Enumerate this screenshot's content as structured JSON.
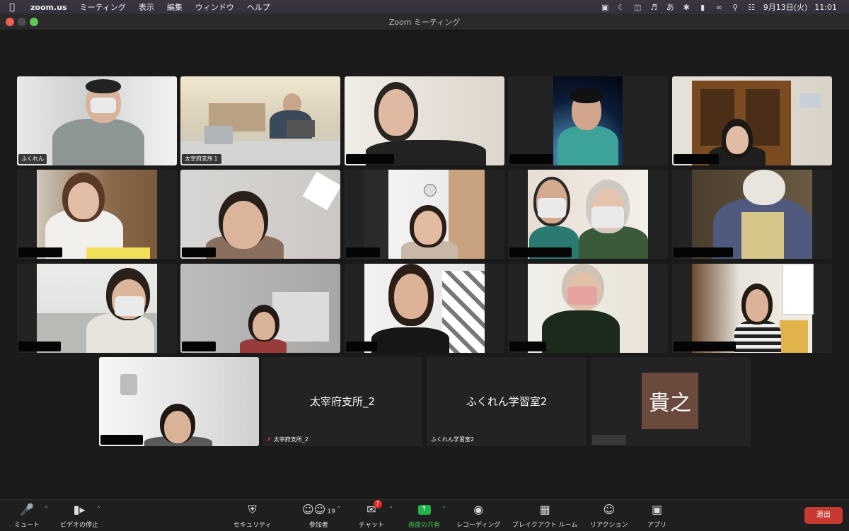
{
  "menubar": {
    "app": "zoom.us",
    "items": [
      "ミーティング",
      "表示",
      "編集",
      "ウィンドウ",
      "ヘルプ"
    ],
    "input_method": "あ",
    "date": "9月13日(火)",
    "time": "11:01"
  },
  "window": {
    "title": "Zoom ミーティング"
  },
  "participants": {
    "tile1": "ふくれん",
    "tile2": "太宰府支所１",
    "tile_dazaifu2_center": "太宰府支所_2",
    "tile_dazaifu2_name": "太宰府支所_2",
    "tile_gakushu_center": "ふくれん学習室2",
    "tile_gakushu_name": "ふくれん学習室2",
    "avatar_text": "貴之"
  },
  "toolbar": {
    "mute": "ミュート",
    "video": "ビデオの停止",
    "security": "セキュリティ",
    "participants": "参加者",
    "participants_count": "19",
    "chat": "チャット",
    "chat_badge": "7",
    "share": "画面の共有",
    "record": "レコーディング",
    "breakout": "ブレイクアウト ルーム",
    "reactions": "リアクション",
    "apps": "アプリ",
    "leave": "退出"
  },
  "colors": {
    "active_speaker": "#3fc24a",
    "leave": "#c73a30",
    "share": "#1fb34a",
    "badge": "#e02828"
  }
}
